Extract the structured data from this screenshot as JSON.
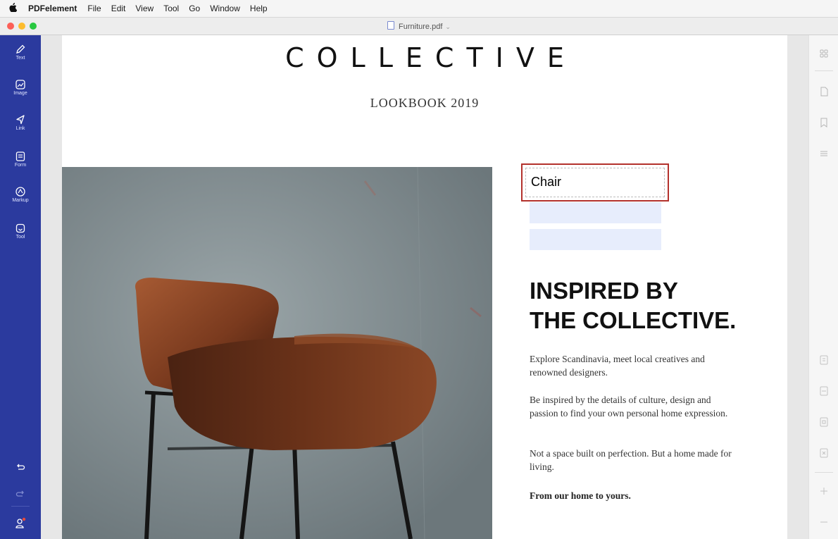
{
  "menubar": {
    "apple_icon": "apple-icon",
    "app_name": "PDFelement",
    "items": [
      "File",
      "Edit",
      "View",
      "Tool",
      "Go",
      "Window",
      "Help"
    ]
  },
  "window": {
    "title": "Furniture.pdf",
    "title_chevron": "⌄"
  },
  "left_toolbar": {
    "items": [
      {
        "label": "Text",
        "icon": "pen-icon"
      },
      {
        "label": "Image",
        "icon": "image-icon"
      },
      {
        "label": "Link",
        "icon": "link-icon"
      },
      {
        "label": "Form",
        "icon": "form-icon"
      },
      {
        "label": "Markup",
        "icon": "markup-icon"
      },
      {
        "label": "Tool",
        "icon": "tool-icon"
      }
    ],
    "bottom": [
      "undo-icon",
      "redo-icon",
      "account-icon"
    ]
  },
  "page": {
    "title": "COLLECTIVE",
    "subtitle": "LOOKBOOK 2019",
    "form_field_value": "Chair",
    "headline_line1": "INSPIRED BY",
    "headline_line2": "THE COLLECTIVE.",
    "para1": "Explore Scandinavia, meet local creatives and renowned designers.",
    "para2": "Be inspired by the details of culture, design and passion to find your own personal home expression.",
    "para3": "Not a space built on perfection. But a home made for living.",
    "para4": "From our home to yours."
  },
  "right_panel": {
    "icons": [
      "grid-icon",
      "page-icon",
      "bookmark-icon",
      "list-icon",
      "field-icon-1",
      "field-icon-2",
      "field-icon-3",
      "field-icon-4",
      "zoom-in-icon",
      "zoom-out-icon"
    ]
  },
  "colors": {
    "toolbar_bg": "#2b3a9e",
    "field_border": "#b3312c",
    "field_fill": "#e7edfc"
  }
}
